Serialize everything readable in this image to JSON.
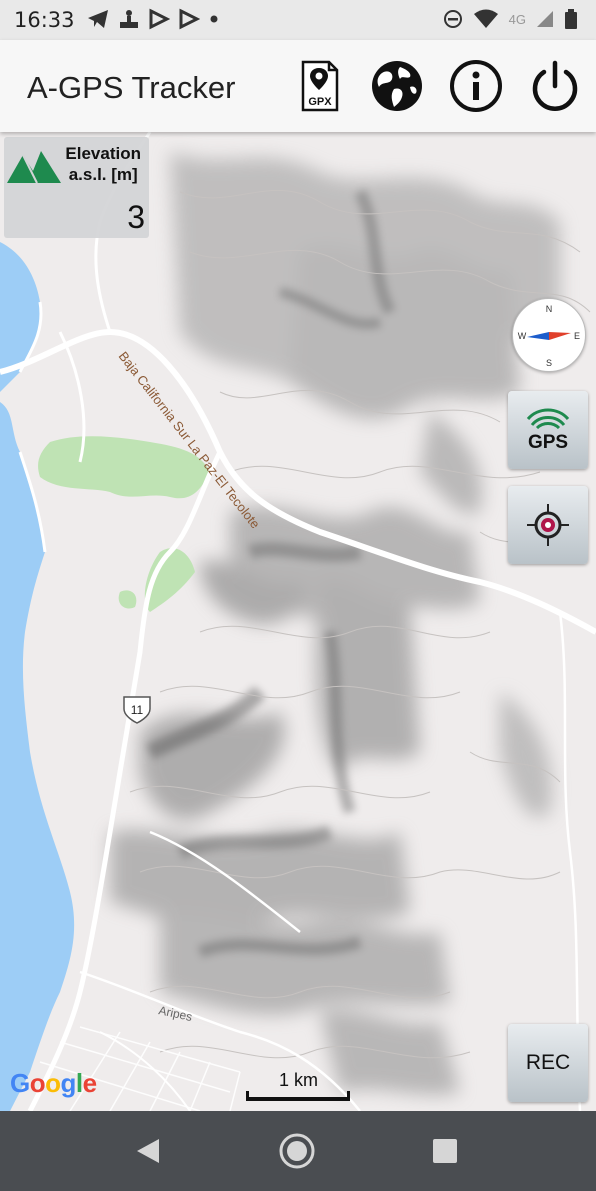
{
  "status_bar": {
    "time": "16:33",
    "network": "4G",
    "icons": [
      "telegram-icon",
      "signal-app-icon",
      "check-icon",
      "check-icon",
      "dot-icon",
      "dnd-icon",
      "wifi-icon",
      "cell-signal-icon",
      "battery-icon"
    ]
  },
  "app_bar": {
    "title": "A-GPS Tracker",
    "gpx_label": "GPX",
    "icons": [
      "gpx-file-icon",
      "globe-icon",
      "info-icon",
      "power-icon"
    ]
  },
  "elevation": {
    "label_line1": "Elevation",
    "label_line2": "a.s.l. [m]",
    "value": "3",
    "icon": "mountains-icon"
  },
  "map": {
    "road_label": "Baja California Sur La Paz-El Tecolote",
    "highway_number": "11",
    "place_label": "Aripes",
    "scale_label": "1 km",
    "attribution": "Google"
  },
  "buttons": {
    "gps_label": "GPS",
    "rec_label": "REC"
  },
  "compass": {
    "n": "N",
    "s": "S",
    "e": "E",
    "w": "W"
  },
  "colors": {
    "water": "#9dcdf6",
    "park": "#bfe3b4",
    "app_bar": "#f7f7f7",
    "nav_bar": "#4a4d51",
    "mountain_green": "#1e8a4e",
    "road_label": "#8b5a36"
  }
}
